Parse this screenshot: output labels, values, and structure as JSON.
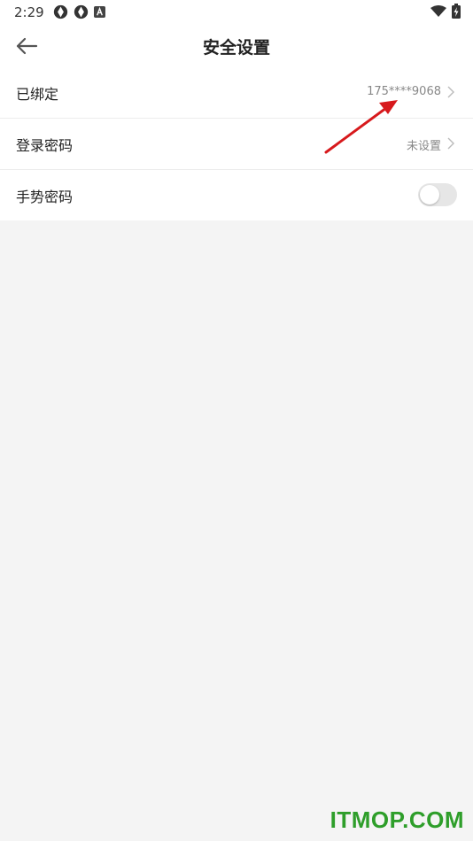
{
  "status_bar": {
    "time": "2:29",
    "left_icons": [
      "aperture-icon",
      "aperture-icon",
      "a-square-icon"
    ],
    "right_icons": [
      "wifi-icon",
      "battery-charging-icon"
    ]
  },
  "header": {
    "title": "安全设置",
    "back_icon": "back-arrow-icon"
  },
  "settings": {
    "bound": {
      "label": "已绑定",
      "value": "175****9068"
    },
    "login_password": {
      "label": "登录密码",
      "value": "未设置"
    },
    "gesture_password": {
      "label": "手势密码",
      "enabled": false
    }
  },
  "watermark": "ITMOP.COM",
  "colors": {
    "annotation_arrow": "#d7191c",
    "watermark": "#2e9e2a",
    "background": "#f4f4f4"
  }
}
